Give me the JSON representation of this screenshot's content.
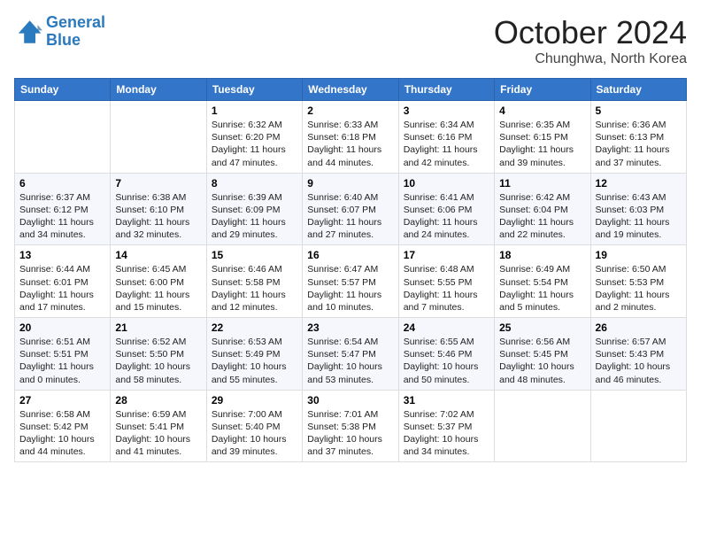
{
  "header": {
    "logo_line1": "General",
    "logo_line2": "Blue",
    "month": "October 2024",
    "location": "Chunghwa, North Korea"
  },
  "weekdays": [
    "Sunday",
    "Monday",
    "Tuesday",
    "Wednesday",
    "Thursday",
    "Friday",
    "Saturday"
  ],
  "weeks": [
    [
      {
        "num": "",
        "text": ""
      },
      {
        "num": "",
        "text": ""
      },
      {
        "num": "1",
        "text": "Sunrise: 6:32 AM\nSunset: 6:20 PM\nDaylight: 11 hours and 47 minutes."
      },
      {
        "num": "2",
        "text": "Sunrise: 6:33 AM\nSunset: 6:18 PM\nDaylight: 11 hours and 44 minutes."
      },
      {
        "num": "3",
        "text": "Sunrise: 6:34 AM\nSunset: 6:16 PM\nDaylight: 11 hours and 42 minutes."
      },
      {
        "num": "4",
        "text": "Sunrise: 6:35 AM\nSunset: 6:15 PM\nDaylight: 11 hours and 39 minutes."
      },
      {
        "num": "5",
        "text": "Sunrise: 6:36 AM\nSunset: 6:13 PM\nDaylight: 11 hours and 37 minutes."
      }
    ],
    [
      {
        "num": "6",
        "text": "Sunrise: 6:37 AM\nSunset: 6:12 PM\nDaylight: 11 hours and 34 minutes."
      },
      {
        "num": "7",
        "text": "Sunrise: 6:38 AM\nSunset: 6:10 PM\nDaylight: 11 hours and 32 minutes."
      },
      {
        "num": "8",
        "text": "Sunrise: 6:39 AM\nSunset: 6:09 PM\nDaylight: 11 hours and 29 minutes."
      },
      {
        "num": "9",
        "text": "Sunrise: 6:40 AM\nSunset: 6:07 PM\nDaylight: 11 hours and 27 minutes."
      },
      {
        "num": "10",
        "text": "Sunrise: 6:41 AM\nSunset: 6:06 PM\nDaylight: 11 hours and 24 minutes."
      },
      {
        "num": "11",
        "text": "Sunrise: 6:42 AM\nSunset: 6:04 PM\nDaylight: 11 hours and 22 minutes."
      },
      {
        "num": "12",
        "text": "Sunrise: 6:43 AM\nSunset: 6:03 PM\nDaylight: 11 hours and 19 minutes."
      }
    ],
    [
      {
        "num": "13",
        "text": "Sunrise: 6:44 AM\nSunset: 6:01 PM\nDaylight: 11 hours and 17 minutes."
      },
      {
        "num": "14",
        "text": "Sunrise: 6:45 AM\nSunset: 6:00 PM\nDaylight: 11 hours and 15 minutes."
      },
      {
        "num": "15",
        "text": "Sunrise: 6:46 AM\nSunset: 5:58 PM\nDaylight: 11 hours and 12 minutes."
      },
      {
        "num": "16",
        "text": "Sunrise: 6:47 AM\nSunset: 5:57 PM\nDaylight: 11 hours and 10 minutes."
      },
      {
        "num": "17",
        "text": "Sunrise: 6:48 AM\nSunset: 5:55 PM\nDaylight: 11 hours and 7 minutes."
      },
      {
        "num": "18",
        "text": "Sunrise: 6:49 AM\nSunset: 5:54 PM\nDaylight: 11 hours and 5 minutes."
      },
      {
        "num": "19",
        "text": "Sunrise: 6:50 AM\nSunset: 5:53 PM\nDaylight: 11 hours and 2 minutes."
      }
    ],
    [
      {
        "num": "20",
        "text": "Sunrise: 6:51 AM\nSunset: 5:51 PM\nDaylight: 11 hours and 0 minutes."
      },
      {
        "num": "21",
        "text": "Sunrise: 6:52 AM\nSunset: 5:50 PM\nDaylight: 10 hours and 58 minutes."
      },
      {
        "num": "22",
        "text": "Sunrise: 6:53 AM\nSunset: 5:49 PM\nDaylight: 10 hours and 55 minutes."
      },
      {
        "num": "23",
        "text": "Sunrise: 6:54 AM\nSunset: 5:47 PM\nDaylight: 10 hours and 53 minutes."
      },
      {
        "num": "24",
        "text": "Sunrise: 6:55 AM\nSunset: 5:46 PM\nDaylight: 10 hours and 50 minutes."
      },
      {
        "num": "25",
        "text": "Sunrise: 6:56 AM\nSunset: 5:45 PM\nDaylight: 10 hours and 48 minutes."
      },
      {
        "num": "26",
        "text": "Sunrise: 6:57 AM\nSunset: 5:43 PM\nDaylight: 10 hours and 46 minutes."
      }
    ],
    [
      {
        "num": "27",
        "text": "Sunrise: 6:58 AM\nSunset: 5:42 PM\nDaylight: 10 hours and 44 minutes."
      },
      {
        "num": "28",
        "text": "Sunrise: 6:59 AM\nSunset: 5:41 PM\nDaylight: 10 hours and 41 minutes."
      },
      {
        "num": "29",
        "text": "Sunrise: 7:00 AM\nSunset: 5:40 PM\nDaylight: 10 hours and 39 minutes."
      },
      {
        "num": "30",
        "text": "Sunrise: 7:01 AM\nSunset: 5:38 PM\nDaylight: 10 hours and 37 minutes."
      },
      {
        "num": "31",
        "text": "Sunrise: 7:02 AM\nSunset: 5:37 PM\nDaylight: 10 hours and 34 minutes."
      },
      {
        "num": "",
        "text": ""
      },
      {
        "num": "",
        "text": ""
      }
    ]
  ]
}
